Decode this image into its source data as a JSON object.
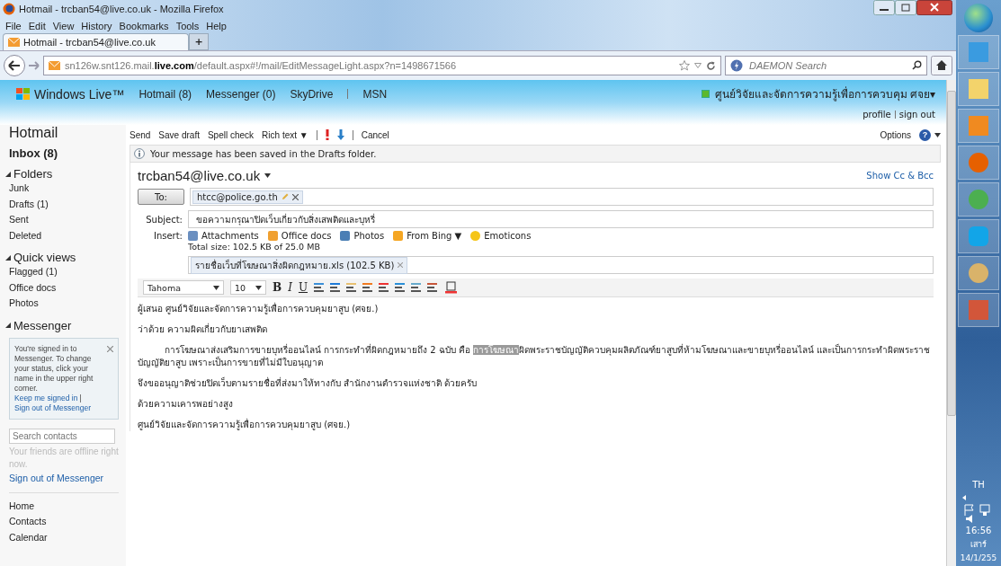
{
  "browser": {
    "title": "Hotmail - trcban54@live.co.uk - Mozilla Firefox",
    "menu": [
      "File",
      "Edit",
      "View",
      "History",
      "Bookmarks",
      "Tools",
      "Help"
    ],
    "tabs": [
      {
        "label": "Hotmail - trcban54@live.co.uk",
        "selected": true
      }
    ],
    "new_tab": "+",
    "url": "sn126w.snt126.mail.**live.com**/default.aspx#!/mail/EditMessageLight.aspx?n=1498671566",
    "search": {
      "placeholder": "DAEMON Search"
    }
  },
  "header": {
    "brand": "Windows Live™",
    "nav": [
      "Hotmail (8)",
      "Messenger (0)",
      "SkyDrive",
      "MSN"
    ],
    "user": "ศูนย์วิจัยและจัดการความรู้เพื่อการควบคุม ศจย▾",
    "links": [
      "profile",
      "sign out"
    ]
  },
  "sidebar": {
    "title": "Hotmail",
    "inbox": "Inbox (8)",
    "sections": [
      {
        "title": "Folders",
        "expanded": true,
        "items": [
          "Junk",
          "Drafts (1)",
          "Sent",
          "Deleted"
        ]
      },
      {
        "title": "Quick views",
        "expanded": true,
        "items": [
          "Flagged (1)",
          "Office docs",
          "Photos"
        ]
      },
      {
        "title": "Messenger",
        "expanded": true
      }
    ],
    "messenger_note": "You're signed in to Messenger. To change your status, click your name in the upper right corner.",
    "note_links": [
      "Keep me signed in",
      "Sign out of Messenger"
    ],
    "contacts_search": {
      "placeholder": "Search contacts"
    },
    "offline": "Your friends are offline right now.",
    "sign_out": "Sign out of Messenger",
    "bottom_links": [
      "Home",
      "Contacts",
      "Calendar"
    ]
  },
  "toolbar": {
    "actions": [
      "Send",
      "Save draft",
      "Spell check",
      "Rich text ▼"
    ],
    "cancel": "Cancel",
    "options": "Options",
    "help_icon": "?"
  },
  "notice": "Your message has been saved in the Drafts folder.",
  "compose": {
    "from": "trcban54@live.co.uk",
    "show_cc": "Show Cc & Bcc",
    "to_button": "To:",
    "recipients": [
      "htcc@police.go.th"
    ],
    "subject_label": "Subject:",
    "subject": "ขอความกรุณาปิดเว็บเกี่ยวกับสิ่งเสพติดและบุหรี่",
    "insert_label": "Insert:",
    "insert_items": [
      {
        "kind": "attachments",
        "label": "Attachments"
      },
      {
        "kind": "office",
        "label": "Office docs"
      },
      {
        "kind": "photos",
        "label": "Photos"
      },
      {
        "kind": "bing",
        "label": "From Bing ▼"
      },
      {
        "kind": "emoticons",
        "label": "Emoticons"
      }
    ],
    "total_size": "Total size: 102.5 KB of 25.0 MB",
    "attachments": [
      "รายชื่อเว็บที่โฆษณาสิ่งผิดกฎหมาย.xls (102.5 KB)"
    ],
    "font": "Tahoma",
    "font_size": "10",
    "format_buttons": [
      {
        "kind": "bold",
        "label": "B"
      },
      {
        "kind": "italic",
        "label": "I"
      },
      {
        "kind": "underline",
        "label": "U"
      }
    ],
    "body": [
      {
        "indented": false,
        "parts": [
          {
            "text": "ผู้เสนอ ศูนย์วิจัยและจัดการความรู้เพื่อการควบคุมยาสูบ (ศจย.)",
            "selected": false
          }
        ]
      },
      {
        "indented": false,
        "parts": [
          {
            "text": "ว่าด้วย ความผิดเกี่ยวกับยาเสพติด",
            "selected": false
          }
        ]
      },
      {
        "indented": true,
        "parts": [
          {
            "text": "การโฆษณาส่งเสริมการขายบุหรี่ออนไลน์ การกระทำที่ผิดกฎหมายถึง 2 ฉบับ คือ ",
            "selected": false
          },
          {
            "text": "การโฆษณา",
            "selected": true
          },
          {
            "text": "ผิดพระราชบัญญัติควบคุมผลิตภัณฑ์ยาสูบที่ห้ามโฆษณาและขายบุหรี่ออนไลน์ และเป็นการกระทำผิดพระราชบัญญัติยาสูบ เพราะเป็นการขายที่ไม่มีใบอนุญาต",
            "selected": false
          }
        ]
      },
      {
        "indented": false,
        "parts": [
          {
            "text": "จึงขออนุญาติช่วยปิดเว็บตามรายชื่อที่ส่งมาให้ทางกับ สำนักงานตำรวจแห่งชาติ ด้วยครับ",
            "selected": false
          }
        ]
      },
      {
        "indented": false,
        "parts": [
          {
            "text": "ด้วยความเคารพอย่างสูง",
            "selected": false
          }
        ]
      },
      {
        "indented": false,
        "parts": [
          {
            "text": "ศูนย์วิจัยและจัดการความรู้เพื่อการควบคุมยาสูบ (ศจย.)",
            "selected": false
          }
        ]
      }
    ]
  },
  "taskbar": {
    "language": "TH",
    "time": "16:56",
    "day": "เสาร์",
    "date": "14/1/255"
  }
}
